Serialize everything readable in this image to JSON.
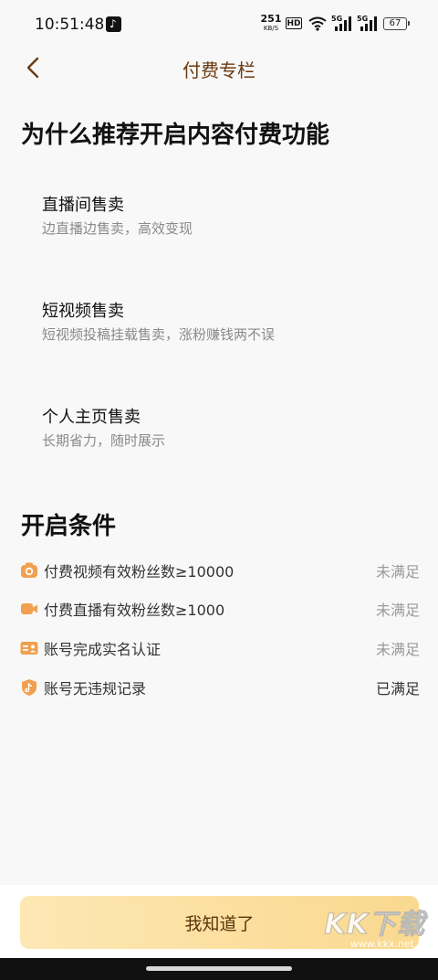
{
  "status_bar": {
    "time": "10:51:48",
    "net_speed_value": "251",
    "net_speed_unit": "KB/S",
    "hd_label": "HD",
    "signal_1_label": "5G",
    "signal_2_label": "5G",
    "battery_level": "67"
  },
  "header": {
    "title": "付费专栏"
  },
  "why_section": {
    "title": "为什么推荐开启内容付费功能",
    "features": [
      {
        "title": "直播间售卖",
        "desc": "边直播边售卖，高效变现"
      },
      {
        "title": "短视频售卖",
        "desc": "短视频投稿挂载售卖，涨粉赚钱两不误"
      },
      {
        "title": "个人主页售卖",
        "desc": "长期省力，随时展示"
      }
    ]
  },
  "conditions_section": {
    "title": "开启条件",
    "items": [
      {
        "icon": "camera-icon",
        "label": "付费视频有效粉丝数≥10000",
        "status": "未满足"
      },
      {
        "icon": "video-camera-icon",
        "label": "付费直播有效粉丝数≥1000",
        "status": "未满足"
      },
      {
        "icon": "id-card-icon",
        "label": "账号完成实名认证",
        "status": "未满足"
      },
      {
        "icon": "shield-icon",
        "label": "账号无违规记录",
        "status": "已满足"
      }
    ]
  },
  "footer": {
    "confirm_label": "我知道了"
  },
  "watermark": {
    "logo": "KK下载",
    "url": "www.kkx.net"
  },
  "colors": {
    "accent_brown": "#6b3a10",
    "icon_orange": "#f0a050",
    "button_gold": "#fad98f"
  }
}
